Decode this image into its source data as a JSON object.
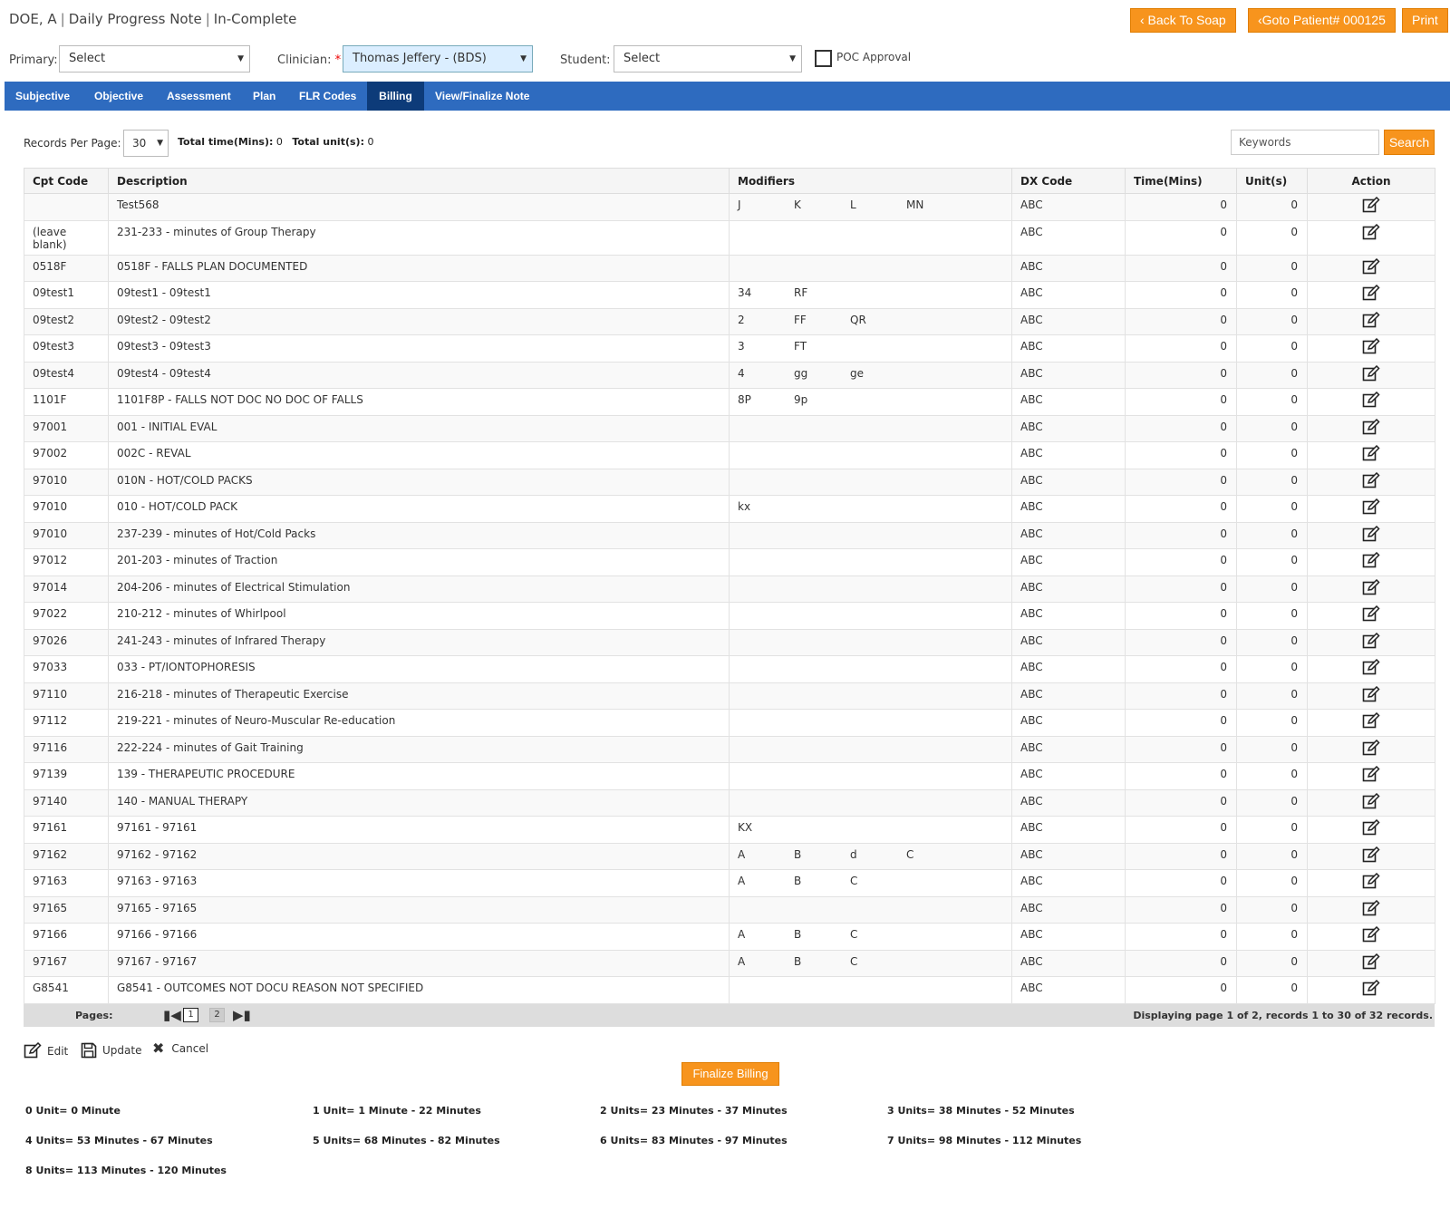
{
  "header": {
    "patient": "DOE, A",
    "note_type": "Daily Progress Note",
    "status": "In-Complete",
    "back_to_soap": "‹ Back To Soap",
    "goto_patient": "‹Goto Patient# 000125",
    "print": "Print"
  },
  "filters": {
    "primary_label": "Primary:",
    "primary_value": "Select",
    "clinician_label": "Clinician:",
    "clinician_required": "*",
    "clinician_value": "Thomas Jeffery - (BDS)",
    "student_label": "Student:",
    "student_value": "Select",
    "poc_label": "POC Approval"
  },
  "tabs": [
    {
      "label": "Subjective"
    },
    {
      "label": "Objective"
    },
    {
      "label": "Assessment"
    },
    {
      "label": "Plan"
    },
    {
      "label": "FLR Codes"
    },
    {
      "label": "Billing",
      "active": true
    },
    {
      "label": "View/Finalize Note"
    }
  ],
  "toolbar": {
    "records_per_page_label": "Records Per Page:",
    "records_per_page": "30",
    "total_time_label": "Total time(Mins):",
    "total_time": "0",
    "total_units_label": "Total unit(s):",
    "total_units": "0",
    "keywords_placeholder": "Keywords",
    "search_label": "Search"
  },
  "table": {
    "headers": [
      "Cpt Code",
      "Description",
      "Modifiers",
      "DX Code",
      "Time(Mins)",
      "Unit(s)",
      "Action"
    ],
    "rows": [
      {
        "cpt": "",
        "desc": "Test568",
        "mods": [
          "J",
          "K",
          "L",
          "MN"
        ],
        "dx": "ABC",
        "time": "0",
        "units": "0"
      },
      {
        "cpt": "(leave blank)",
        "desc": "231-233 - minutes of Group Therapy",
        "mods": [],
        "dx": "ABC",
        "time": "0",
        "units": "0"
      },
      {
        "cpt": "0518F",
        "desc": "0518F - FALLS PLAN DOCUMENTED",
        "mods": [],
        "dx": "ABC",
        "time": "0",
        "units": "0"
      },
      {
        "cpt": "09test1",
        "desc": "09test1 - 09test1",
        "mods": [
          "34",
          "RF"
        ],
        "dx": "ABC",
        "time": "0",
        "units": "0"
      },
      {
        "cpt": "09test2",
        "desc": "09test2 - 09test2",
        "mods": [
          "2",
          "FF",
          "QR"
        ],
        "dx": "ABC",
        "time": "0",
        "units": "0"
      },
      {
        "cpt": "09test3",
        "desc": "09test3 - 09test3",
        "mods": [
          "3",
          "FT"
        ],
        "dx": "ABC",
        "time": "0",
        "units": "0"
      },
      {
        "cpt": "09test4",
        "desc": "09test4 - 09test4",
        "mods": [
          "4",
          "gg",
          "ge"
        ],
        "dx": "ABC",
        "time": "0",
        "units": "0"
      },
      {
        "cpt": "1101F",
        "desc": "1101F8P - FALLS NOT DOC NO DOC OF FALLS",
        "mods": [
          "8P",
          "9p"
        ],
        "dx": "ABC",
        "time": "0",
        "units": "0"
      },
      {
        "cpt": "97001",
        "desc": "001 - INITIAL EVAL",
        "mods": [],
        "dx": "ABC",
        "time": "0",
        "units": "0"
      },
      {
        "cpt": "97002",
        "desc": "002C - REVAL",
        "mods": [],
        "dx": "ABC",
        "time": "0",
        "units": "0"
      },
      {
        "cpt": "97010",
        "desc": "010N - HOT/COLD PACKS",
        "mods": [],
        "dx": "ABC",
        "time": "0",
        "units": "0"
      },
      {
        "cpt": "97010",
        "desc": "010 - HOT/COLD PACK",
        "mods": [
          "kx"
        ],
        "dx": "ABC",
        "time": "0",
        "units": "0"
      },
      {
        "cpt": "97010",
        "desc": "237-239 - minutes of Hot/Cold Packs",
        "mods": [],
        "dx": "ABC",
        "time": "0",
        "units": "0"
      },
      {
        "cpt": "97012",
        "desc": "201-203 - minutes of Traction",
        "mods": [],
        "dx": "ABC",
        "time": "0",
        "units": "0"
      },
      {
        "cpt": "97014",
        "desc": "204-206 - minutes of Electrical Stimulation",
        "mods": [],
        "dx": "ABC",
        "time": "0",
        "units": "0"
      },
      {
        "cpt": "97022",
        "desc": "210-212 - minutes of Whirlpool",
        "mods": [],
        "dx": "ABC",
        "time": "0",
        "units": "0"
      },
      {
        "cpt": "97026",
        "desc": "241-243 - minutes of Infrared Therapy",
        "mods": [],
        "dx": "ABC",
        "time": "0",
        "units": "0"
      },
      {
        "cpt": "97033",
        "desc": "033 - PT/IONTOPHORESIS",
        "mods": [],
        "dx": "ABC",
        "time": "0",
        "units": "0"
      },
      {
        "cpt": "97110",
        "desc": "216-218 - minutes of Therapeutic Exercise",
        "mods": [],
        "dx": "ABC",
        "time": "0",
        "units": "0"
      },
      {
        "cpt": "97112",
        "desc": "219-221 - minutes of Neuro-Muscular Re-education",
        "mods": [],
        "dx": "ABC",
        "time": "0",
        "units": "0"
      },
      {
        "cpt": "97116",
        "desc": "222-224 - minutes of Gait Training",
        "mods": [],
        "dx": "ABC",
        "time": "0",
        "units": "0"
      },
      {
        "cpt": "97139",
        "desc": "139 - THERAPEUTIC PROCEDURE",
        "mods": [],
        "dx": "ABC",
        "time": "0",
        "units": "0"
      },
      {
        "cpt": "97140",
        "desc": "140 - MANUAL THERAPY",
        "mods": [],
        "dx": "ABC",
        "time": "0",
        "units": "0"
      },
      {
        "cpt": "97161",
        "desc": "97161 - 97161",
        "mods": [
          "KX"
        ],
        "dx": "ABC",
        "time": "0",
        "units": "0"
      },
      {
        "cpt": "97162",
        "desc": "97162 - 97162",
        "mods": [
          "A",
          "B",
          "d",
          "C"
        ],
        "dx": "ABC",
        "time": "0",
        "units": "0"
      },
      {
        "cpt": "97163",
        "desc": "97163 - 97163",
        "mods": [
          "A",
          "B",
          "C"
        ],
        "dx": "ABC",
        "time": "0",
        "units": "0"
      },
      {
        "cpt": "97165",
        "desc": "97165 - 97165",
        "mods": [],
        "dx": "ABC",
        "time": "0",
        "units": "0"
      },
      {
        "cpt": "97166",
        "desc": "97166 - 97166",
        "mods": [
          "A",
          "B",
          "C"
        ],
        "dx": "ABC",
        "time": "0",
        "units": "0"
      },
      {
        "cpt": "97167",
        "desc": "97167 - 97167",
        "mods": [
          "A",
          "B",
          "C"
        ],
        "dx": "ABC",
        "time": "0",
        "units": "0"
      },
      {
        "cpt": "G8541",
        "desc": "G8541 - OUTCOMES NOT DOCU REASON NOT SPECIFIED",
        "mods": [],
        "dx": "ABC",
        "time": "0",
        "units": "0"
      }
    ]
  },
  "pager": {
    "label": "Pages:",
    "pages": [
      "1",
      "2"
    ],
    "current": "1",
    "display": "Displaying page 1 of 2, records 1 to 30 of 32 records."
  },
  "actions": {
    "edit": "Edit",
    "update": "Update",
    "cancel": "Cancel",
    "finalize": "Finalize Billing"
  },
  "unit_legend": [
    "0 Unit= 0 Minute",
    "1 Unit= 1 Minute - 22 Minutes",
    "2 Units= 23 Minutes - 37 Minutes",
    "3 Units= 38 Minutes - 52 Minutes",
    "4 Units= 53 Minutes - 67 Minutes",
    "5 Units= 68 Minutes - 82 Minutes",
    "6 Units= 83 Minutes - 97 Minutes",
    "7 Units= 98 Minutes - 112 Minutes",
    "8 Units= 113 Minutes - 120 Minutes"
  ],
  "colors": {
    "accent_orange": "#f7941d",
    "nav_blue": "#2e6bbf",
    "nav_active": "#0d3b79"
  }
}
